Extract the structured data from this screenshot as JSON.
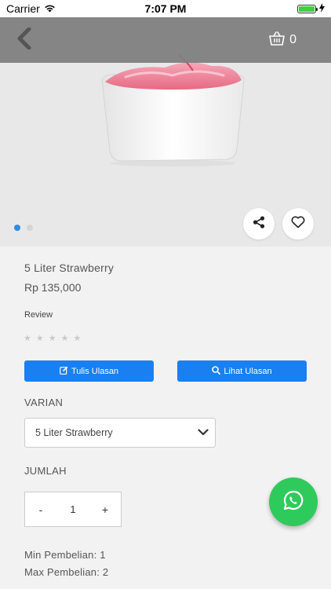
{
  "status_bar": {
    "carrier": "Carrier",
    "time": "7:07 PM"
  },
  "header": {
    "cart_count": "0"
  },
  "carousel": {
    "total_dots": 2,
    "active_index": 0
  },
  "product": {
    "name": "5 Liter Strawberry",
    "price": "Rp 135,000",
    "review_label": "Review",
    "rating": 0,
    "max_rating": 5
  },
  "actions": {
    "write_review_label": "Tulis Ulasan",
    "view_review_label": "Lihat Ulasan"
  },
  "variant": {
    "label": "VARIAN",
    "selected": "5 Liter Strawberry"
  },
  "quantity": {
    "label": "JUMLAH",
    "decrement": "-",
    "value": "1",
    "increment": "+"
  },
  "limits": {
    "min_text": "Min Pembelian: 1",
    "max_text": "Max Pembelian: 2"
  },
  "colors": {
    "accent": "#1a7ff0",
    "whatsapp": "#2fca5c",
    "header_overlay": "#808080",
    "active_dot": "#2f8de4"
  },
  "icons": {
    "back": "chevron-left-icon",
    "cart": "basket-icon",
    "share": "share-icon",
    "like": "heart-icon",
    "write": "edit-icon",
    "view": "search-icon",
    "dropdown": "chevron-down-icon",
    "whatsapp": "whatsapp-icon"
  }
}
